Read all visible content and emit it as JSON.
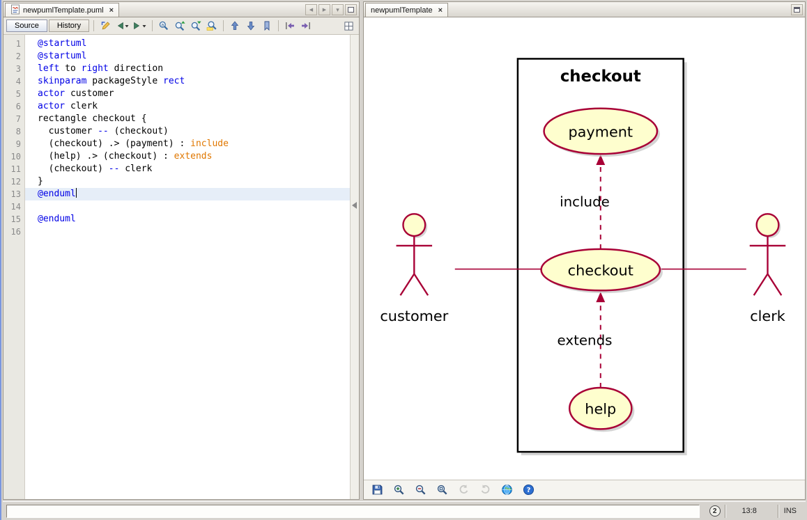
{
  "theme": {
    "keyword": "#0000e6",
    "literal": "#e07700",
    "maroon": "#a80036",
    "shape-fill": "#fefece",
    "current-line": "#e6eef8"
  },
  "glyphs": {
    "close": "×",
    "scroll-left": "◀",
    "scroll-right": "▶",
    "tab-list": "▾"
  },
  "left_pane": {
    "tab": {
      "label": "newpumlTemplate.puml"
    },
    "toolbar": {
      "source": "Source",
      "history": "History",
      "buttons": [
        {
          "name": "last-edit-button",
          "icon": "last-edit"
        },
        {
          "name": "back-button",
          "icon": "back",
          "dropdown": true
        },
        {
          "name": "forward-button",
          "icon": "forward",
          "dropdown": true
        },
        {
          "sep": true
        },
        {
          "name": "find-selection-button",
          "icon": "find-selection"
        },
        {
          "name": "find-previous-occurrence-button",
          "icon": "find-previous"
        },
        {
          "name": "find-next-occurrence-button",
          "icon": "find-next"
        },
        {
          "name": "toggle-highlight-search-button",
          "icon": "toggle-highlight"
        },
        {
          "sep": true
        },
        {
          "name": "previous-bookmark-button",
          "icon": "previous-bookmark"
        },
        {
          "name": "next-bookmark-button",
          "icon": "next-bookmark"
        },
        {
          "name": "toggle-bookmark-button",
          "icon": "toggle-bookmark"
        },
        {
          "sep": true
        },
        {
          "name": "shift-left-button",
          "icon": "shift-left"
        },
        {
          "name": "shift-right-button",
          "icon": "shift-right"
        }
      ]
    }
  },
  "editor": {
    "lines": [
      {
        "tokens": [
          {
            "t": "kw",
            "s": "@startuml"
          }
        ]
      },
      {
        "tokens": [
          {
            "t": "kw",
            "s": "@startuml"
          }
        ]
      },
      {
        "tokens": [
          {
            "t": "kw",
            "s": "left"
          },
          {
            "t": "p",
            "s": " to "
          },
          {
            "t": "kw",
            "s": "right"
          },
          {
            "t": "p",
            "s": " direction"
          }
        ]
      },
      {
        "tokens": [
          {
            "t": "kw",
            "s": "skinparam"
          },
          {
            "t": "p",
            "s": " packageStyle "
          },
          {
            "t": "kw",
            "s": "rect"
          }
        ]
      },
      {
        "tokens": [
          {
            "t": "kw",
            "s": "actor"
          },
          {
            "t": "p",
            "s": " customer"
          }
        ]
      },
      {
        "tokens": [
          {
            "t": "kw",
            "s": "actor"
          },
          {
            "t": "p",
            "s": " clerk"
          }
        ]
      },
      {
        "tokens": [
          {
            "t": "p",
            "s": "rectangle checkout {"
          }
        ]
      },
      {
        "tokens": [
          {
            "t": "p",
            "s": "  customer "
          },
          {
            "t": "kw",
            "s": "--"
          },
          {
            "t": "p",
            "s": " (checkout)"
          }
        ]
      },
      {
        "tokens": [
          {
            "t": "p",
            "s": "  (checkout) .> (payment) : "
          },
          {
            "t": "lit",
            "s": "include"
          }
        ]
      },
      {
        "tokens": [
          {
            "t": "p",
            "s": "  (help) .> (checkout) : "
          },
          {
            "t": "lit",
            "s": "extends"
          }
        ]
      },
      {
        "tokens": [
          {
            "t": "p",
            "s": "  (checkout) "
          },
          {
            "t": "kw",
            "s": "--"
          },
          {
            "t": "p",
            "s": " clerk"
          }
        ]
      },
      {
        "tokens": [
          {
            "t": "p",
            "s": "}"
          }
        ]
      },
      {
        "tokens": [
          {
            "t": "kw",
            "s": "@enduml"
          }
        ],
        "current": true,
        "caret": true
      },
      {
        "tokens": []
      },
      {
        "tokens": [
          {
            "t": "kw",
            "s": "@enduml"
          }
        ]
      },
      {
        "tokens": []
      }
    ]
  },
  "right_pane": {
    "tab": {
      "label": "newpumlTemplate"
    },
    "toolbar": {
      "buttons": [
        {
          "name": "export-image-button",
          "icon": "save"
        },
        {
          "name": "zoom-in-button",
          "icon": "zoom-in"
        },
        {
          "name": "zoom-out-button",
          "icon": "zoom-out"
        },
        {
          "name": "zoom-reset-button",
          "icon": "zoom-reset"
        },
        {
          "name": "rotate-left-button",
          "icon": "rotate-ccw",
          "disabled": true
        },
        {
          "name": "rotate-right-button",
          "icon": "rotate-cw",
          "disabled": true
        },
        {
          "name": "open-in-browser-button",
          "icon": "globe"
        },
        {
          "name": "about-button",
          "icon": "help"
        }
      ]
    }
  },
  "diagram": {
    "package_title": "checkout",
    "usecases": {
      "payment": "payment",
      "checkout": "checkout",
      "help": "help"
    },
    "actors": {
      "customer": "customer",
      "clerk": "clerk"
    },
    "edge_labels": {
      "include": "include",
      "extends": "extends"
    }
  },
  "statusbar": {
    "badge": "2",
    "caret_position": "13:8",
    "insert_mode": "INS"
  }
}
